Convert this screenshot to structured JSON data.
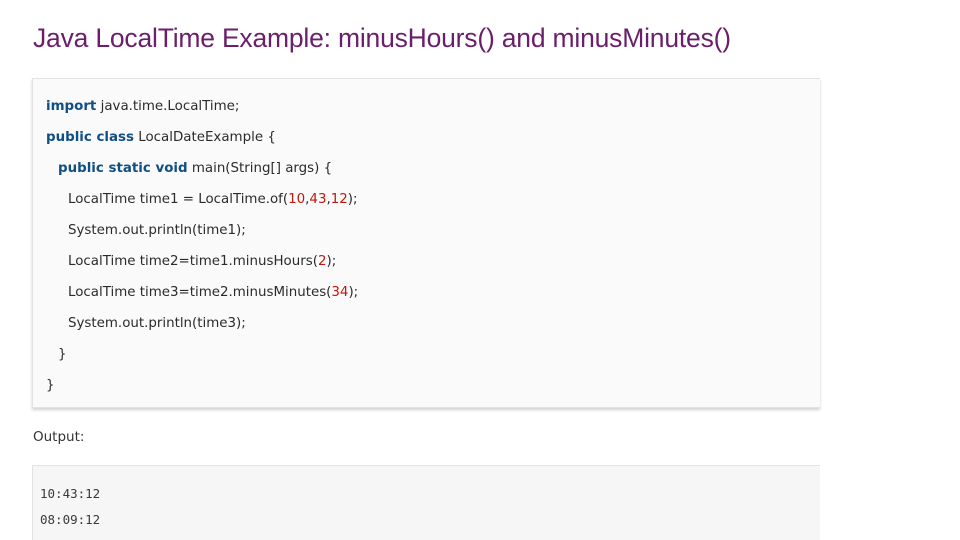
{
  "title": "Java LocalTime Example: minusHours() and minusMinutes()",
  "code": {
    "line1": {
      "kw": "import",
      "rest": " java.time.LocalTime;"
    },
    "line2": {
      "kw": "public class",
      "rest": " LocalDateExample {"
    },
    "line3": {
      "kw": "public static void",
      "rest": " main(String[] args) {"
    },
    "line4": {
      "a": "LocalTime time1 = LocalTime.of(",
      "n1": "10",
      "c1": ",",
      "n2": "43",
      "c2": ",",
      "n3": "12",
      "b": ");"
    },
    "line5": "System.out.println(time1);",
    "line6": {
      "a": "LocalTime time2=time1.minusHours(",
      "n": "2",
      "b": ");"
    },
    "line7": {
      "a": "LocalTime time3=time2.minusMinutes(",
      "n": "34",
      "b": ");"
    },
    "line8": "System.out.println(time3);",
    "line9": "}",
    "line10": "}"
  },
  "output_label": "Output:",
  "output": [
    "10:43:12",
    "08:09:12"
  ],
  "colors": {
    "title": "#6b1f6a",
    "keyword": "#0f4f84",
    "number": "#c0170f",
    "text": "#2b2b2b"
  }
}
